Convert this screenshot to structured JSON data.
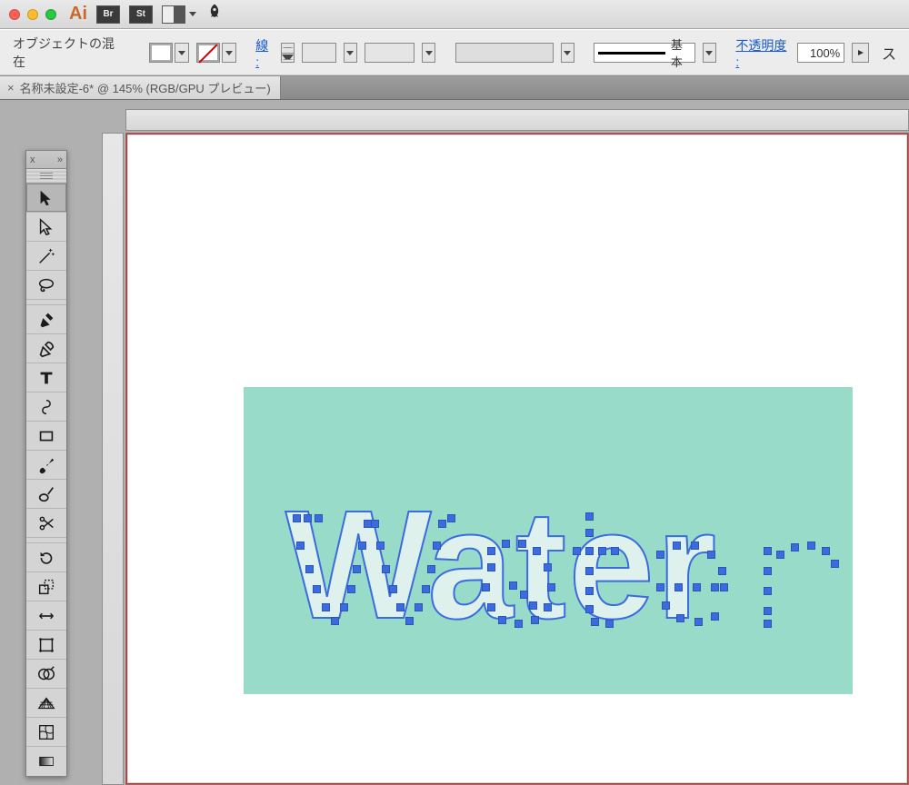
{
  "titlebar": {
    "app": "Ai",
    "br": "Br",
    "st": "St"
  },
  "controlbar": {
    "label": "オブジェクトの混在",
    "stroke_label": "線 :",
    "brush_label": "基本",
    "opacity_label": "不透明度 :",
    "opacity_value": "100%",
    "end_letter": "ス"
  },
  "tab": {
    "title": "名称未設定-6* @ 145% (RGB/GPU プレビュー)",
    "close": "×"
  },
  "art": {
    "text": "Water"
  },
  "tools_header": {
    "x": "x",
    "chev": "»"
  }
}
